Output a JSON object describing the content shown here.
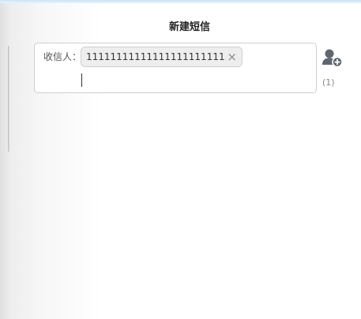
{
  "dialog": {
    "title": "新建短信"
  },
  "recipients": {
    "label": "收信人：",
    "chips": [
      {
        "text": "11111111111111111111111111...",
        "remove_glyph": "×"
      }
    ],
    "input_value": "",
    "count_text": "(1)"
  },
  "icons": {
    "add_contact": "add-contact-icon",
    "remove": "close-icon"
  },
  "colors": {
    "chip_bg": "#eeeeee",
    "icon_gray": "#5f6670",
    "border": "#cfcfcf"
  }
}
